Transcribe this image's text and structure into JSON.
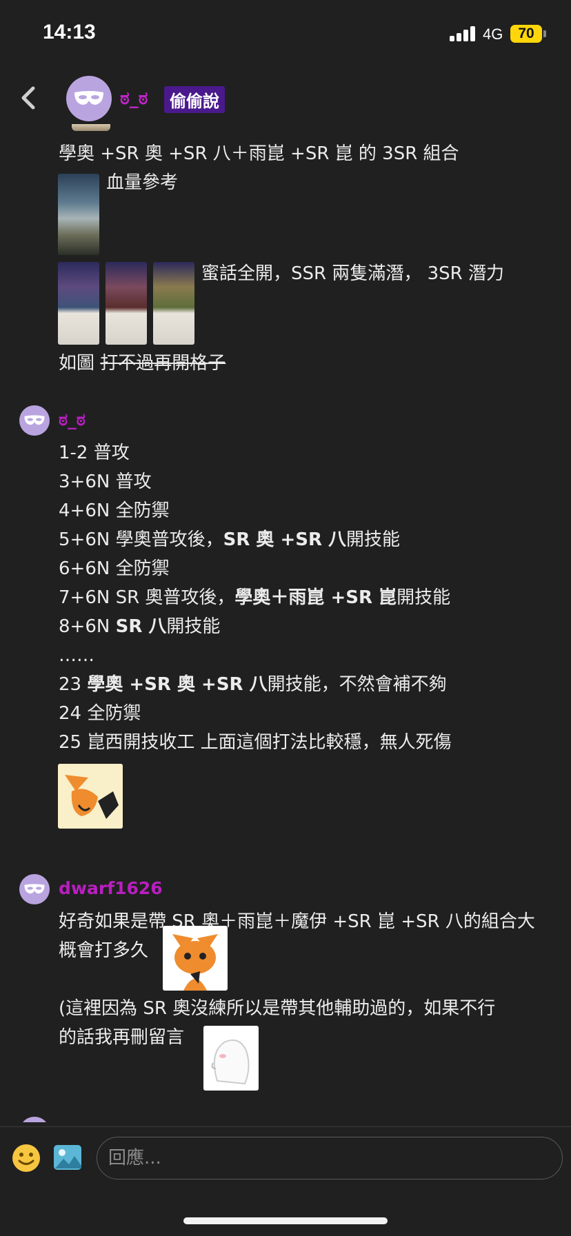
{
  "status_bar": {
    "time": "14:13",
    "network": "4G",
    "battery": "70"
  },
  "header": {
    "poster_name": "ಠ_ಠ",
    "tag": "偷偷說"
  },
  "post": {
    "line1": "學奧 +SR 奧 +SR 八＋雨崑 +SR 崑 的 3SR 組合",
    "hp_ref": "血量參考",
    "line3": "蜜話全開，SSR 兩隻滿潛，  3SR 潛力",
    "line4_plain": "如圖 ",
    "line4_strike": "打不過再開格子"
  },
  "comments": [
    {
      "name": "ಠ_ಠ",
      "lines": [
        {
          "segments": [
            {
              "t": "1-2     普攻"
            }
          ]
        },
        {
          "segments": [
            {
              "t": "3+6N 普攻"
            }
          ]
        },
        {
          "segments": [
            {
              "t": "4+6N 全防禦"
            }
          ]
        },
        {
          "segments": [
            {
              "t": "5+6N 學奧普攻後，"
            },
            {
              "t": "SR 奧 +SR 八",
              "b": true
            },
            {
              "t": "開技能"
            }
          ]
        },
        {
          "segments": [
            {
              "t": "6+6N 全防禦"
            }
          ]
        },
        {
          "segments": [
            {
              "t": "7+6N SR 奧普攻後，"
            },
            {
              "t": "學奧＋雨崑 +SR 崑",
              "b": true
            },
            {
              "t": "開技能"
            }
          ]
        },
        {
          "segments": [
            {
              "t": "8+6N "
            },
            {
              "t": "SR 八",
              "b": true
            },
            {
              "t": "開技能"
            }
          ]
        },
        {
          "segments": [
            {
              "t": "……"
            }
          ]
        },
        {
          "segments": [
            {
              "t": "23 "
            },
            {
              "t": "學奧 +SR 奧 +SR 八",
              "b": true
            },
            {
              "t": "開技能，不然會補不夠"
            }
          ]
        },
        {
          "segments": [
            {
              "t": "24 全防禦"
            }
          ]
        },
        {
          "segments": [
            {
              "t": "25 崑西開技收工 上面這個打法比較穩，無人死傷"
            }
          ]
        }
      ]
    },
    {
      "name": "dwarf1626",
      "lines": [
        {
          "segments": [
            {
              "t": "好奇如果是帶 SR 奧＋雨崑＋魔伊 +SR 崑 +SR 八的組合大"
            }
          ]
        },
        {
          "segments": [
            {
              "t": "概會打多久"
            }
          ]
        },
        {
          "segments": [
            {
              "t": "(這裡因為 SR 奧沒練所以是帶其他輔助過的，如果不行"
            }
          ]
        },
        {
          "segments": [
            {
              "t": "的話我再刪留言"
            }
          ]
        }
      ]
    }
  ],
  "composer": {
    "placeholder": "回應..."
  },
  "icons": {
    "back": "chevron-left-icon",
    "emoji": "smiley-icon",
    "image": "image-icon",
    "avatar": "mask-icon"
  },
  "colors": {
    "background": "#202020",
    "username": "#b81fc0",
    "tag_bg": "#4a1a8c",
    "avatar_bg": "#b9a4e0",
    "battery": "#ffd60a"
  }
}
